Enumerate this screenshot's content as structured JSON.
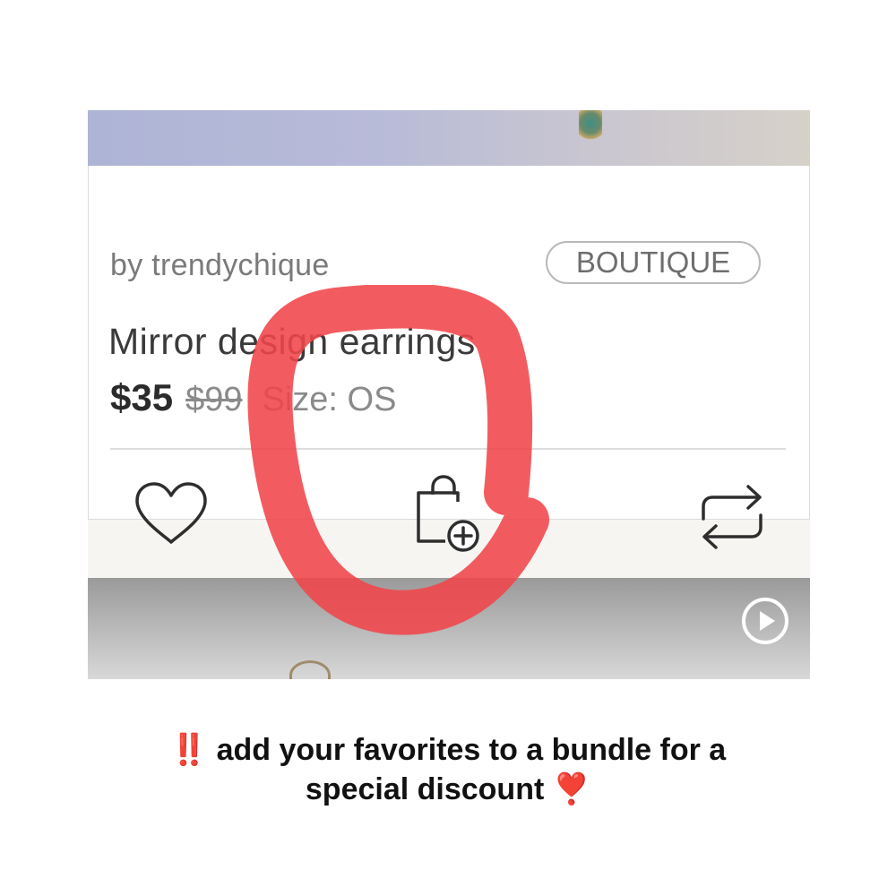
{
  "listing": {
    "seller": "by trendychique",
    "badge": "BOUTIQUE",
    "title": "Mirror design earrings",
    "price": "$35",
    "original_price": "$99",
    "size": "Size: OS"
  },
  "actions": {
    "like_icon": "heart-icon",
    "bundle_icon": "shopping-bag-plus-icon",
    "share_icon": "repost-icon"
  },
  "next_listing": {
    "media_icon": "play-icon"
  },
  "annotation": {
    "color": "#f0464a"
  },
  "caption": {
    "prefix": "‼️",
    "line1": "add your favorites to a bundle for a",
    "line2": "special discount",
    "suffix": "❣️"
  }
}
